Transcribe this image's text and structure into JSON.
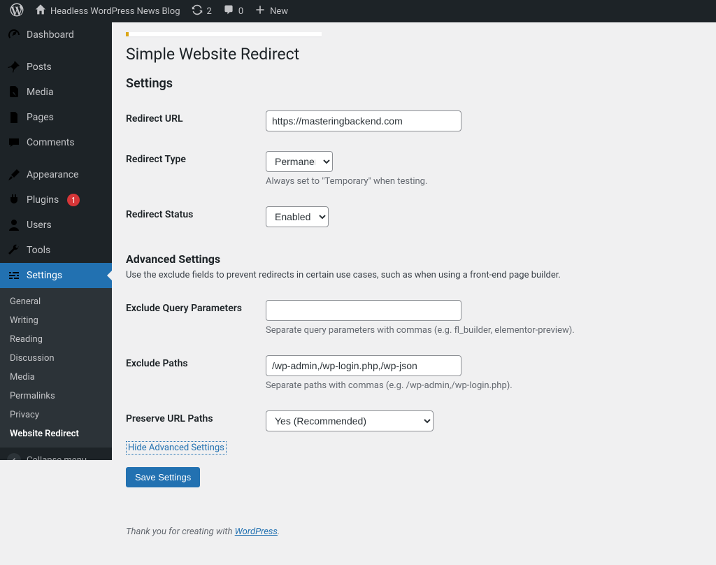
{
  "adminbar": {
    "site_title": "Headless WordPress News Blog",
    "updates_count": "2",
    "comments_count": "0",
    "new_label": "New"
  },
  "sidebar": {
    "items": [
      {
        "label": "Dashboard"
      },
      {
        "label": "Posts"
      },
      {
        "label": "Media"
      },
      {
        "label": "Pages"
      },
      {
        "label": "Comments"
      },
      {
        "label": "Appearance"
      },
      {
        "label": "Plugins",
        "badge": "1"
      },
      {
        "label": "Users"
      },
      {
        "label": "Tools"
      },
      {
        "label": "Settings"
      }
    ],
    "submenu": [
      {
        "label": "General"
      },
      {
        "label": "Writing"
      },
      {
        "label": "Reading"
      },
      {
        "label": "Discussion"
      },
      {
        "label": "Media"
      },
      {
        "label": "Permalinks"
      },
      {
        "label": "Privacy"
      },
      {
        "label": "Website Redirect"
      }
    ],
    "collapse_label": "Collapse menu"
  },
  "page": {
    "title": "Simple Website Redirect",
    "settings_heading": "Settings",
    "advanced_heading": "Advanced Settings",
    "advanced_desc": "Use the exclude fields to prevent redirects in certain use cases, such as when using a front-end page builder.",
    "toggle_label": "Hide Advanced Settings",
    "save_label": "Save Settings",
    "footer_prefix": "Thank you for creating with ",
    "footer_link": "WordPress",
    "footer_suffix": "."
  },
  "fields": {
    "redirect_url": {
      "label": "Redirect URL",
      "value": "https://masteringbackend.com"
    },
    "redirect_type": {
      "label": "Redirect Type",
      "value": "Permanent",
      "help": "Always set to \"Temporary\" when testing."
    },
    "redirect_status": {
      "label": "Redirect Status",
      "value": "Enabled"
    },
    "exclude_query": {
      "label": "Exclude Query Parameters",
      "value": "",
      "help": "Separate query parameters with commas (e.g. fl_builder, elementor-preview)."
    },
    "exclude_paths": {
      "label": "Exclude Paths",
      "value": "/wp-admin,/wp-login.php,/wp-json",
      "help": "Separate paths with commas (e.g. /wp-admin,/wp-login.php)."
    },
    "preserve_paths": {
      "label": "Preserve URL Paths",
      "value": "Yes (Recommended)"
    }
  }
}
